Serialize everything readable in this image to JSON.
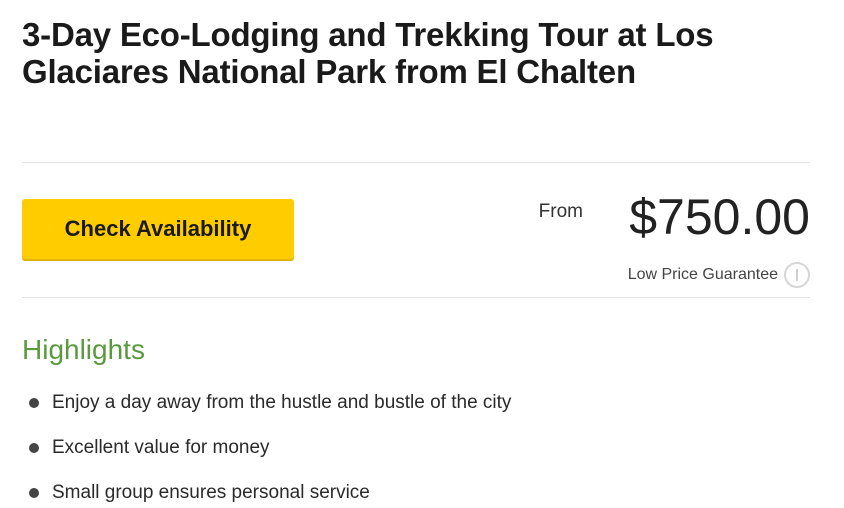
{
  "tour": {
    "title": "3-Day Eco-Lodging and Trekking Tour at Los Glaciares National Park from El Chalten"
  },
  "booking": {
    "cta_label": "Check Availability",
    "from_label": "From",
    "price": "$750.00",
    "guarantee_label": "Low Price Guarantee",
    "info_icon": "info-icon"
  },
  "highlights": {
    "title": "Highlights",
    "items": [
      {
        "text": "Enjoy a day away from the hustle and bustle of the city"
      },
      {
        "text": "Excellent value for money"
      },
      {
        "text": "Small group ensures personal service"
      }
    ]
  },
  "colors": {
    "cta_background": "#ffcc00",
    "highlights_heading": "#5a9a3e",
    "divider": "#e3e3e3"
  }
}
